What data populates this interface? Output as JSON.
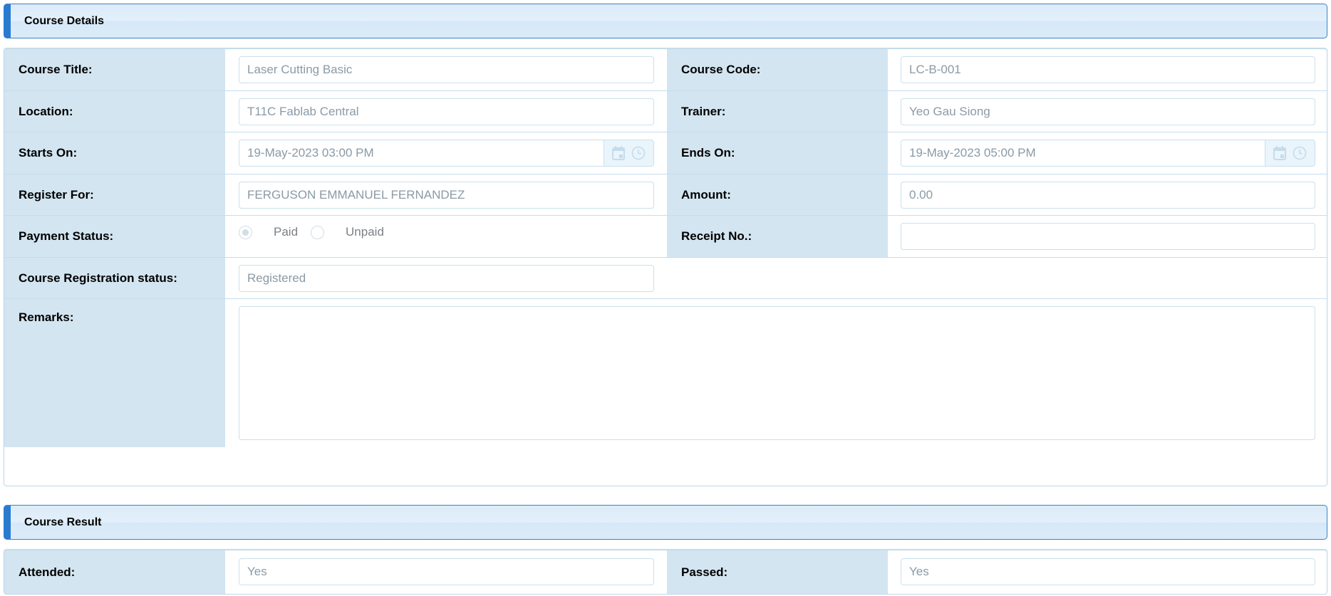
{
  "course_details": {
    "title": "Course Details",
    "course_title": {
      "label": "Course Title:",
      "value": "Laser Cutting Basic"
    },
    "course_code": {
      "label": "Course Code:",
      "value": "LC-B-001"
    },
    "location": {
      "label": "Location:",
      "value": "T11C Fablab Central"
    },
    "trainer": {
      "label": "Trainer:",
      "value": "Yeo Gau Siong"
    },
    "starts_on": {
      "label": "Starts On:",
      "value": "19-May-2023 03:00 PM"
    },
    "ends_on": {
      "label": "Ends On:",
      "value": "19-May-2023 05:00 PM"
    },
    "register_for": {
      "label": "Register For:",
      "value": "FERGUSON EMMANUEL FERNANDEZ"
    },
    "amount": {
      "label": "Amount:",
      "value": "0.00"
    },
    "payment_status": {
      "label": "Payment Status:",
      "options": [
        {
          "label": "Paid",
          "checked": true
        },
        {
          "label": "Unpaid",
          "checked": false
        }
      ]
    },
    "receipt_no": {
      "label": "Receipt No.:",
      "value": ""
    },
    "registration_status": {
      "label": "Course Registration status:",
      "value": "Registered"
    },
    "remarks": {
      "label": "Remarks:",
      "value": ""
    }
  },
  "course_result": {
    "title": "Course Result",
    "attended": {
      "label": "Attended:",
      "value": "Yes"
    },
    "passed": {
      "label": "Passed:",
      "value": "Yes"
    }
  },
  "icons": {
    "calendar": "calendar-icon",
    "clock": "clock-icon"
  },
  "colors": {
    "header_accent": "#2a7bd0",
    "label_bg": "#d3e5f0",
    "field_text": "#8a9aa6"
  }
}
